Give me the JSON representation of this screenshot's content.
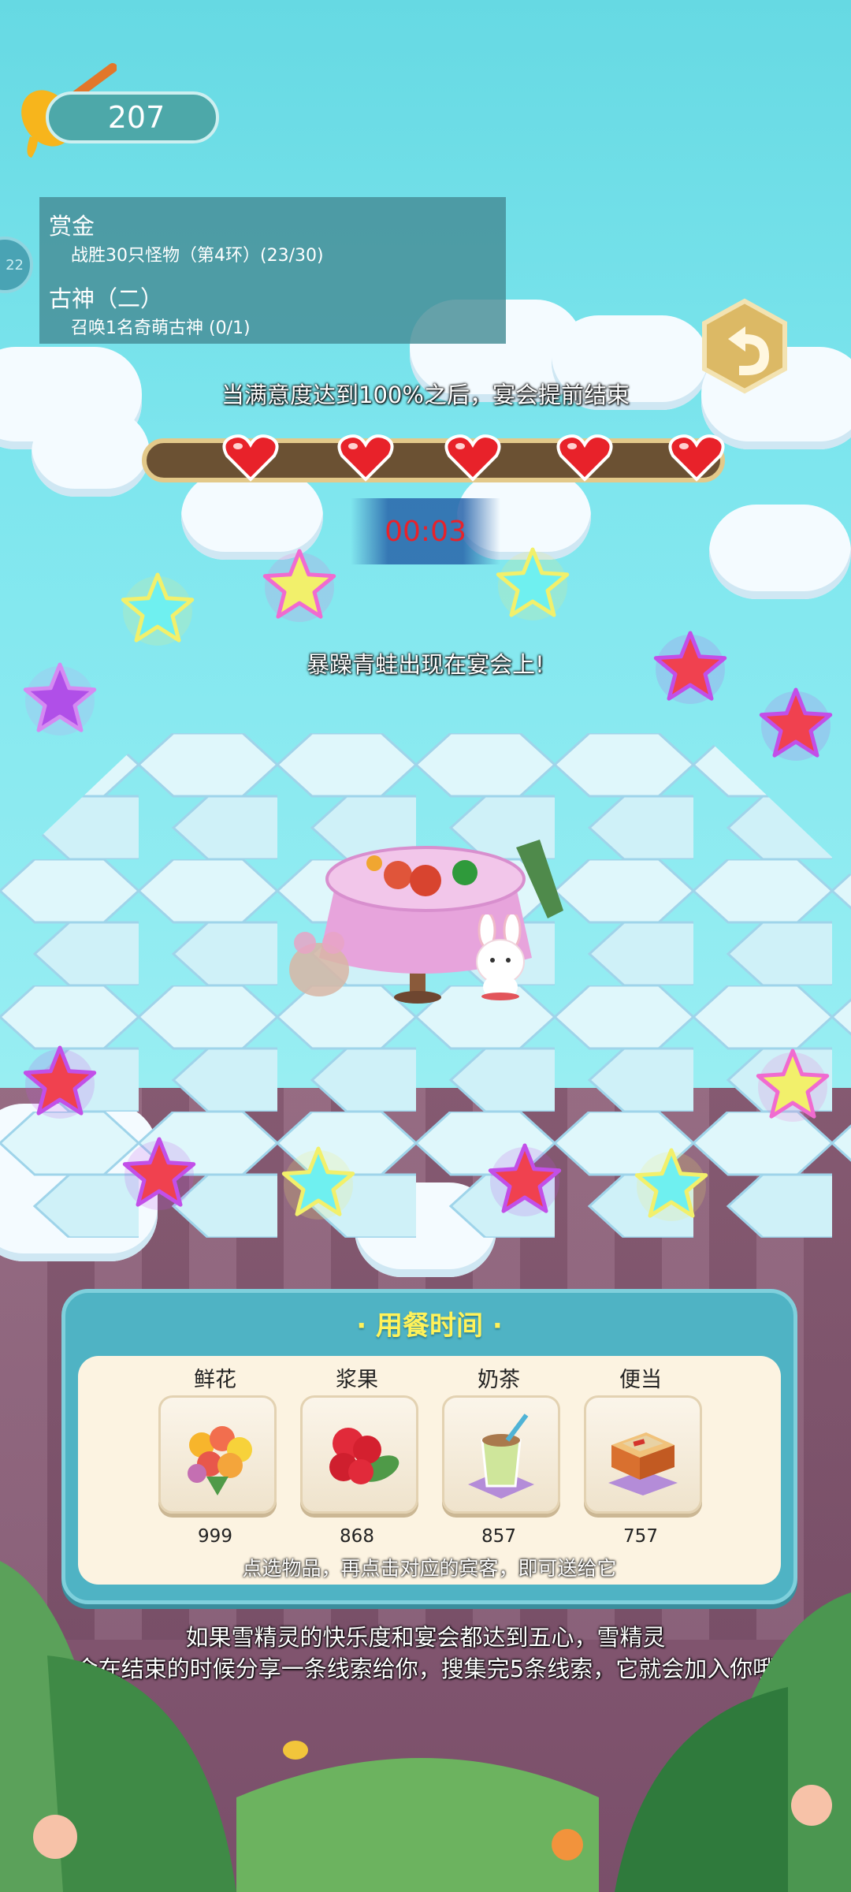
{
  "hud": {
    "honey_count": "207",
    "side_badge": "22"
  },
  "quests": [
    {
      "title": "赏金",
      "detail": "战胜30只怪物（第4环）(23/30)"
    },
    {
      "title": "古神（二）",
      "detail": "召唤1名奇萌古神 (0/1)"
    }
  ],
  "banquet": {
    "satisfaction_hint": "当满意度达到100%之后，宴会提前结束",
    "hearts_filled": 5,
    "hearts_total": 5,
    "timer": "00:03",
    "event_text": "暴躁青蛙出现在宴会上!"
  },
  "meal_panel": {
    "title": "· 用餐时间 ·",
    "items": [
      {
        "name": "鲜花",
        "count": "999",
        "icon": "flower-bouquet-icon"
      },
      {
        "name": "浆果",
        "count": "868",
        "icon": "raspberry-icon"
      },
      {
        "name": "奶茶",
        "count": "857",
        "icon": "milk-tea-icon"
      },
      {
        "name": "便当",
        "count": "757",
        "icon": "bento-box-icon"
      }
    ],
    "hint": "点选物品，再点击对应的宾客，即可送给它"
  },
  "bottom_hint": {
    "line1": "如果雪精灵的快乐度和宴会都达到五心，雪精灵",
    "line2": "会在结束的时候分享一条线索给你，搜集完5条线索，它就会加入你哦"
  },
  "colors": {
    "heart": "#e8222a",
    "timer": "#e8222a",
    "panel_title": "#fff25a"
  }
}
